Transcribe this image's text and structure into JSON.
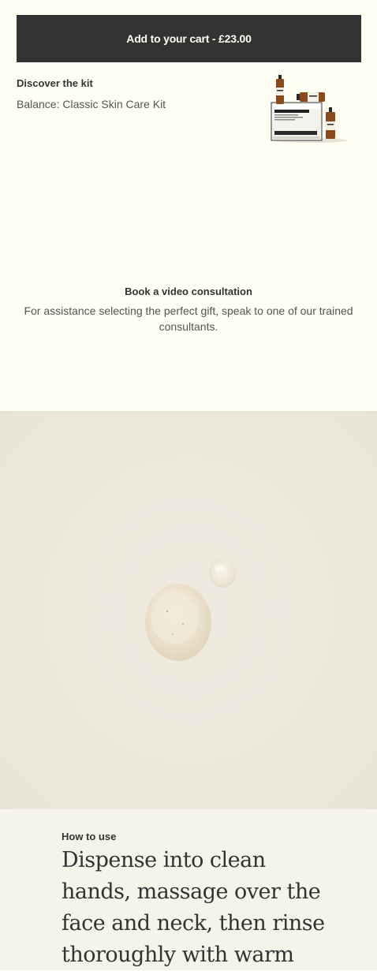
{
  "cart": {
    "button_label": "Add to your cart - £23.00"
  },
  "kit": {
    "heading": "Discover the kit",
    "name": "Balance: Classic Skin Care Kit",
    "image_icon": "skin-care-kit-product-image"
  },
  "consultation": {
    "title": "Book a video consultation",
    "description": "For assistance selecting the perfect gift, speak to one of our trained consultants."
  },
  "hero": {
    "image_icon": "product-texture-droplets-image"
  },
  "how_to_use": {
    "label": "How to use",
    "text": "Dispense into clean hands, massage over the face and neck, then rinse thoroughly with warm"
  },
  "colors": {
    "page_background": "#fffef2",
    "button_background": "#333333",
    "button_text": "#fffef2",
    "hero_background": "#ece8dc",
    "how_section_background": "#f5f4e9"
  }
}
